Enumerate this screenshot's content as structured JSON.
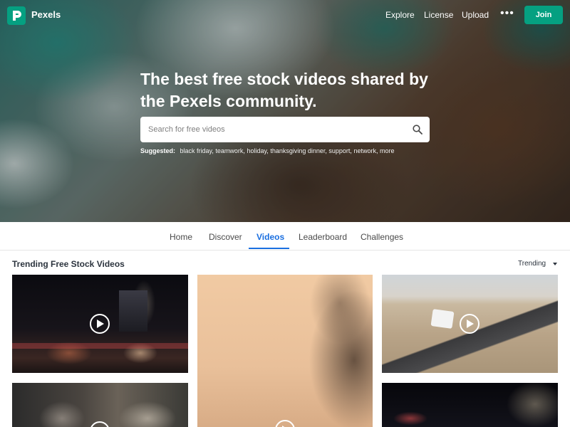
{
  "brand": {
    "name": "Pexels",
    "accent_color": "#05a081"
  },
  "nav": {
    "explore": "Explore",
    "license": "License",
    "upload": "Upload",
    "more_icon": "more-dots-icon",
    "join": "Join"
  },
  "hero": {
    "headline": "The best free stock videos shared by the Pexels community.",
    "search_placeholder": "Search for free videos",
    "suggested_label": "Suggested:",
    "suggested_tags": [
      "black friday",
      "teamwork",
      "holiday",
      "thanksgiving dinner",
      "support",
      "network",
      "more"
    ]
  },
  "tabs": [
    {
      "label": "Home",
      "active": false
    },
    {
      "label": "Discover",
      "active": false
    },
    {
      "label": "Videos",
      "active": true
    },
    {
      "label": "Leaderboard",
      "active": false
    },
    {
      "label": "Challenges",
      "active": false
    }
  ],
  "section": {
    "title": "Trending Free Stock Videos",
    "sort_value": "Trending"
  },
  "videos": [
    {
      "scene": "city street at night"
    },
    {
      "scene": "plant shadow on beige wall"
    },
    {
      "scene": "white car on desert road"
    },
    {
      "scene": "living room interior"
    },
    {
      "scene": "city buildings at night"
    }
  ],
  "colors": {
    "active_tab": "#1a6fe0"
  }
}
